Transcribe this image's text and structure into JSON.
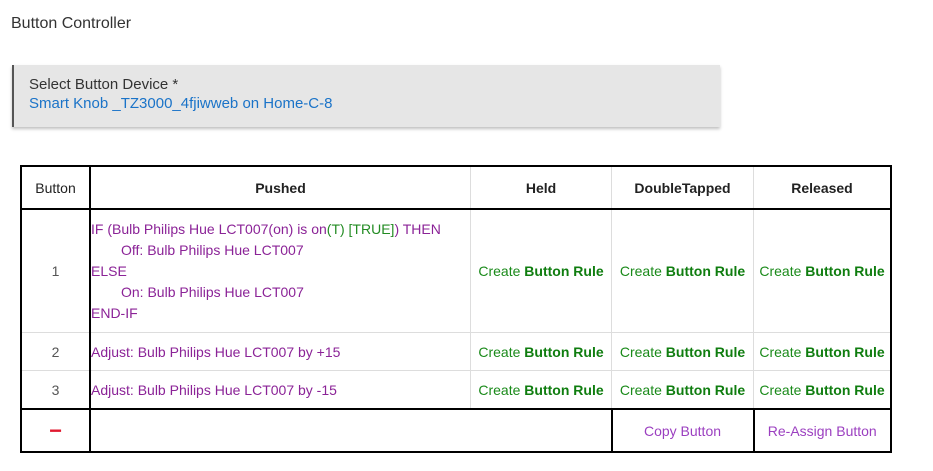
{
  "page": {
    "title": "Button Controller"
  },
  "device": {
    "label": "Select Button Device *",
    "value": "Smart Knob _TZ3000_4fjiwweb on Home-C-8"
  },
  "table": {
    "headers": {
      "button": "Button",
      "pushed": "Pushed",
      "held": "Held",
      "double_tapped": "DoubleTapped",
      "released": "Released"
    },
    "rows": [
      {
        "number": "1",
        "pushed": {
          "if_prefix": "IF (Bulb Philips Hue LCT007(on) is on",
          "if_t": "(T) [TRUE]",
          "if_suffix": ") THEN",
          "then_action": "Off: Bulb Philips Hue LCT007",
          "else": "ELSE",
          "else_action": "On: Bulb Philips Hue LCT007",
          "end": "END-IF"
        }
      },
      {
        "number": "2",
        "pushed": "Adjust: Bulb Philips Hue LCT007 by +15"
      },
      {
        "number": "3",
        "pushed": "Adjust: Bulb Philips Hue LCT007 by -15"
      }
    ],
    "create_prefix": "Create ",
    "create_bold": "Button Rule",
    "footer": {
      "minus": "−",
      "copy": "Copy Button",
      "reassign": "Re-Assign Button"
    }
  },
  "colors": {
    "link_blue": "#1a73c8",
    "rule_purple": "#8b2397",
    "create_green": "#1a8a1a",
    "minus_red": "#e0192f",
    "action_purple": "#9b3fc0"
  }
}
